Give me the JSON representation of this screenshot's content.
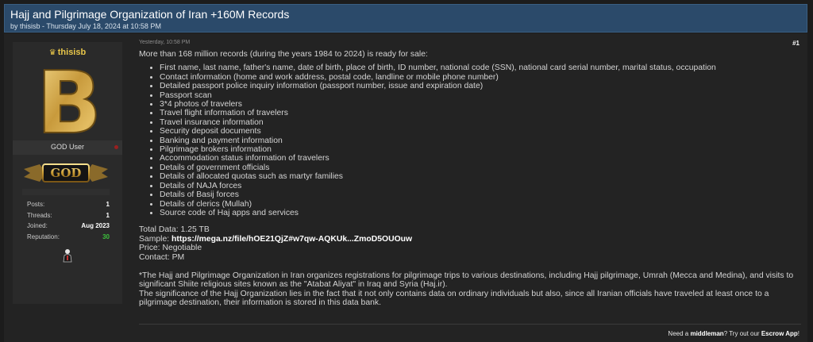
{
  "thread": {
    "title": "Hajj and Pilgrimage Organization of Iran +160M Records",
    "byline": "by thisisb - Thursday July 18, 2024 at 10:58 PM"
  },
  "user": {
    "username": "thisisb",
    "avatar_letter": "B",
    "user_title": "GOD User",
    "rank_badge": "GOD",
    "stats": [
      {
        "label": "Posts:",
        "value": "1"
      },
      {
        "label": "Threads:",
        "value": "1"
      },
      {
        "label": "Joined:",
        "value": "Aug 2023"
      },
      {
        "label": "Reputation:",
        "value": "30"
      }
    ]
  },
  "post": {
    "date": "Yesterday, 10:58 PM",
    "number": "#1",
    "intro": "More than 168 million records (during the years 1984 to 2024) is ready for sale:",
    "items": [
      "First name, last name, father's name, date of birth, place of birth, ID number, national code (SSN), national card serial number, marital status, occupation",
      "Contact information (home and work address, postal code, landline or mobile phone number)",
      "Detailed passport police inquiry information (passport number, issue and expiration date)",
      "Passport scan",
      "3*4 photos of travelers",
      "Travel flight information of travelers",
      "Travel insurance information",
      "Security deposit documents",
      "Banking and payment information",
      "Pilgrimage brokers information",
      "Accommodation status information of travelers",
      "Details of government officials",
      "Details of allocated quotas such as martyr families",
      "Details of NAJA forces",
      "Details of Basij forces",
      "Details of clerics (Mullah)",
      "Source code of Haj apps and services"
    ],
    "total_data": "Total Data: 1.25 TB",
    "sample_label": "Sample: ",
    "sample_link": "https://mega.nz/file/hOE21QjZ#w7qw-AQKUk...ZmoD5OUOuw",
    "price": "Price: Negotiable",
    "contact": "Contact: PM",
    "note1": "*The Hajj and Pilgrimage Organization in Iran organizes registrations for pilgrimage trips to various destinations, including Hajj pilgrimage, Umrah (Mecca and Medina), and visits to significant Shiite religious sites known as the \"Atabat Aliyat\" in Iraq and Syria (Haj.ir).",
    "note2": "The significance of the Hajj Organization lies in the fact that it not only contains data on ordinary individuals but also, since all Iranian officials have traveled at least once to a pilgrimage destination, their information is stored in this data bank."
  },
  "signature": {
    "part1": "Need a ",
    "bold1": "middleman",
    "part2": "? Try out our ",
    "bold2": "Escrow App",
    "part3": "!"
  },
  "colors": {
    "header_bg": "#2b4a6a",
    "username": "#e8c64a",
    "reputation": "#3cc13c",
    "offline": "#9a2020"
  }
}
